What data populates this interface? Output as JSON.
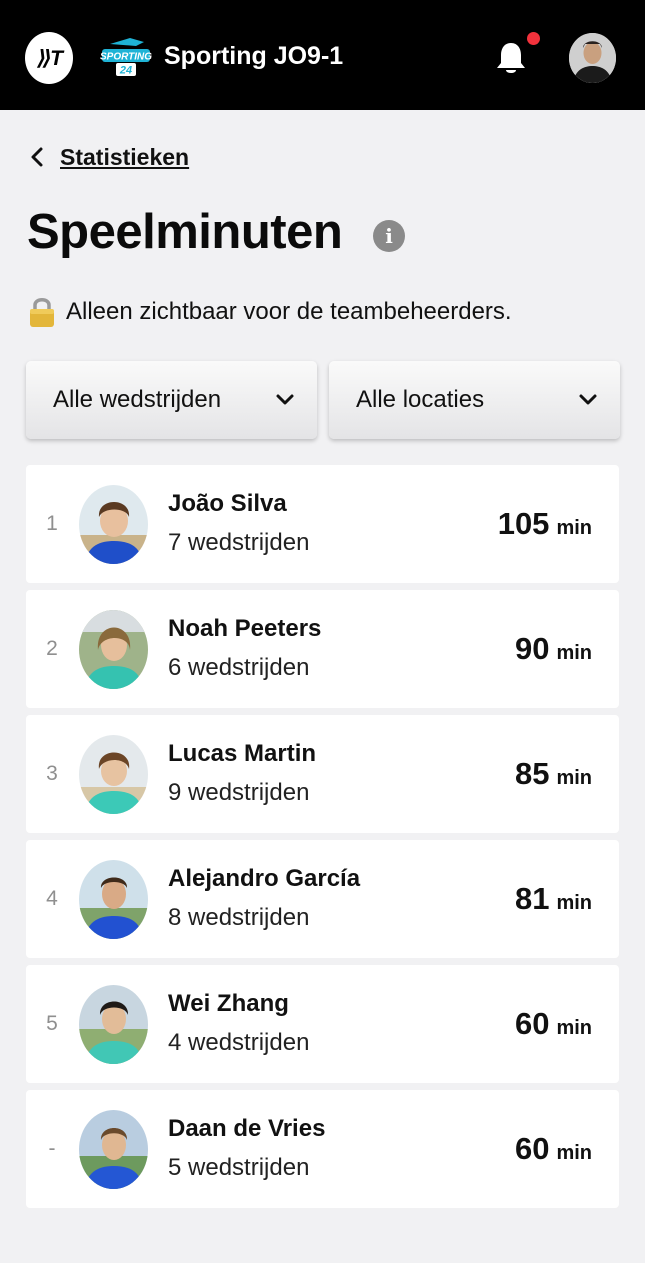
{
  "header": {
    "app_logo_text": "⟫T",
    "club_logo_text": [
      "SPORTING",
      "24"
    ],
    "team_name": "Sporting JO9-1",
    "has_notification": true
  },
  "nav": {
    "back_label": "Statistieken"
  },
  "page": {
    "title": "Speelminuten",
    "info_icon": "i",
    "notice": "Alleen zichtbaar voor de teambeheerders."
  },
  "filters": {
    "matches": "Alle wedstrijden",
    "locations": "Alle locaties"
  },
  "players": [
    {
      "rank": "1",
      "name": "João Silva",
      "matches": "7 wedstrijden",
      "minutes": "105",
      "unit": "min"
    },
    {
      "rank": "2",
      "name": "Noah Peeters",
      "matches": "6 wedstrijden",
      "minutes": "90",
      "unit": "min"
    },
    {
      "rank": "3",
      "name": "Lucas Martin",
      "matches": "9 wedstrijden",
      "minutes": "85",
      "unit": "min"
    },
    {
      "rank": "4",
      "name": "Alejandro García",
      "matches": "8 wedstrijden",
      "minutes": "81",
      "unit": "min"
    },
    {
      "rank": "5",
      "name": "Wei Zhang",
      "matches": "4 wedstrijden",
      "minutes": "60",
      "unit": "min"
    },
    {
      "rank": "-",
      "name": "Daan de Vries",
      "matches": "5 wedstrijden",
      "minutes": "60",
      "unit": "min"
    }
  ],
  "colors": {
    "header_bg": "#000000",
    "page_bg": "#f1f1f3",
    "notification_dot": "#f2323c",
    "club_logo": "#1fb3d6"
  }
}
